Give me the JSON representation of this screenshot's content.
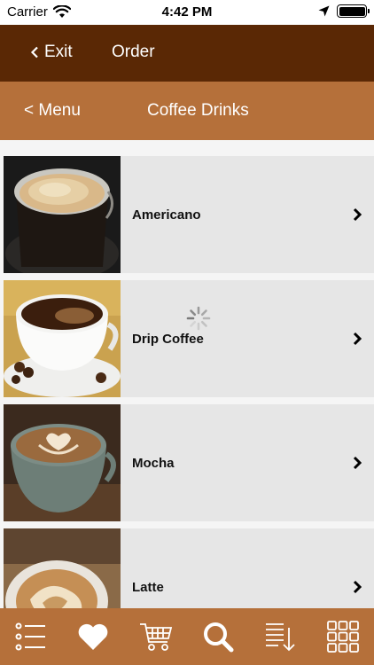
{
  "status_bar": {
    "carrier": "Carrier",
    "time": "4:42 PM",
    "icons": [
      "wifi-icon",
      "location-arrow-icon",
      "battery-icon"
    ]
  },
  "topnav": {
    "exit_label": "Exit",
    "title": "Order"
  },
  "subnav": {
    "back_label": "< Menu",
    "title": "Coffee Drinks"
  },
  "menu_items": [
    {
      "label": "Americano",
      "image": "americano-photo"
    },
    {
      "label": "Drip Coffee",
      "image": "drip-coffee-photo"
    },
    {
      "label": "Mocha",
      "image": "mocha-photo"
    },
    {
      "label": "Latte",
      "image": "latte-photo"
    }
  ],
  "tabbar": {
    "tabs": [
      "list-icon",
      "heart-icon",
      "cart-icon",
      "search-icon",
      "sort-icon",
      "grid-icon"
    ]
  },
  "colors": {
    "topnav_bg": "#5a2805",
    "subnav_bg": "#b5703a",
    "tabbar_bg": "#b5703a",
    "row_bg": "#e6e6e6"
  }
}
